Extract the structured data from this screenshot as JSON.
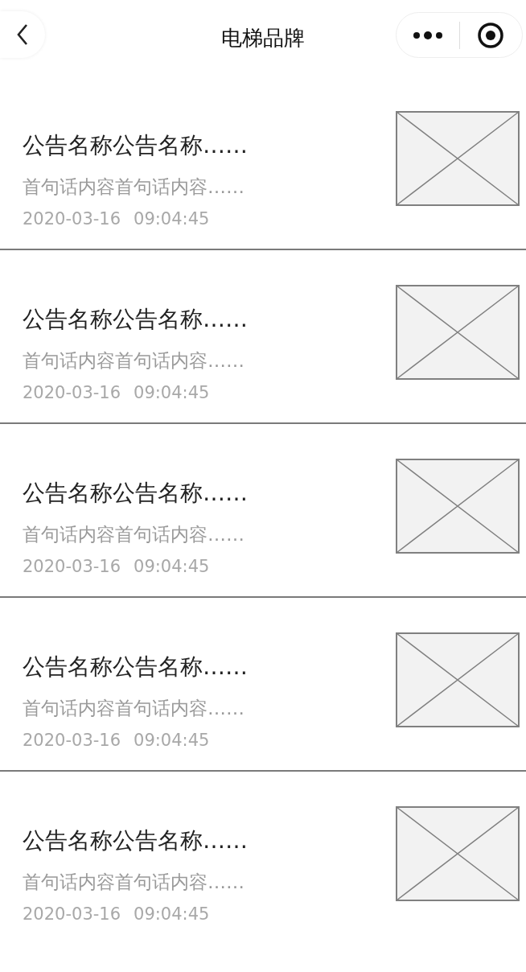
{
  "nav": {
    "title": "电梯品牌"
  },
  "notices": [
    {
      "title": "公告名称公告名称……",
      "summary": "首句话内容首句话内容……",
      "date": "2020-03-16",
      "time": "09:04:45"
    },
    {
      "title": "公告名称公告名称……",
      "summary": "首句话内容首句话内容……",
      "date": "2020-03-16",
      "time": "09:04:45"
    },
    {
      "title": "公告名称公告名称……",
      "summary": "首句话内容首句话内容……",
      "date": "2020-03-16",
      "time": "09:04:45"
    },
    {
      "title": "公告名称公告名称……",
      "summary": "首句话内容首句话内容……",
      "date": "2020-03-16",
      "time": "09:04:45"
    },
    {
      "title": "公告名称公告名称……",
      "summary": "首句话内容首句话内容……",
      "date": "2020-03-16",
      "time": "09:04:45"
    }
  ]
}
